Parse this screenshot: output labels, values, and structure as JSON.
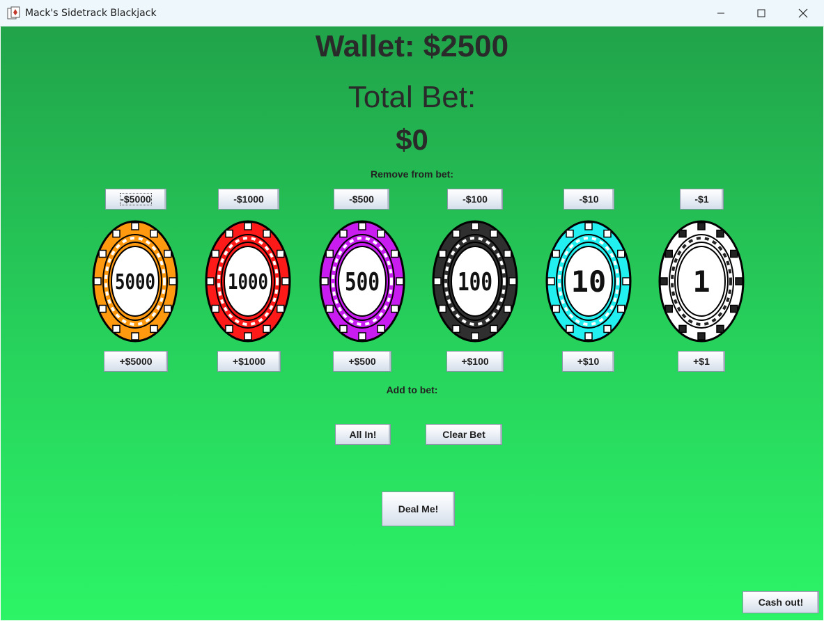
{
  "window": {
    "title": "Mack's Sidetrack Blackjack",
    "controls": [
      "minimize",
      "maximize",
      "close"
    ]
  },
  "wallet_text": "Wallet: $2500",
  "total_bet_label": "Total Bet:",
  "total_bet_value": "$0",
  "remove_label": "Remove from bet:",
  "add_label": "Add to bet:",
  "chips": [
    {
      "value": "5000",
      "color": "#ff9a10",
      "remove_label": "-$5000",
      "add_label": "+$5000"
    },
    {
      "value": "1000",
      "color": "#ff1a1a",
      "remove_label": "-$1000",
      "add_label": "+$1000"
    },
    {
      "value": "500",
      "color": "#c81cf0",
      "remove_label": "-$500",
      "add_label": "+$500"
    },
    {
      "value": "100",
      "color": "#2f2f2f",
      "remove_label": "-$100",
      "add_label": "+$100"
    },
    {
      "value": "10",
      "color": "#22f0f0",
      "remove_label": "-$10",
      "add_label": "+$10"
    },
    {
      "value": "1",
      "color": "#ffffff",
      "remove_label": "-$1",
      "add_label": "+$1"
    }
  ],
  "all_in_label": "All In!",
  "clear_bet_label": "Clear Bet",
  "deal_label": "Deal Me!",
  "cash_out_label": "Cash out!"
}
